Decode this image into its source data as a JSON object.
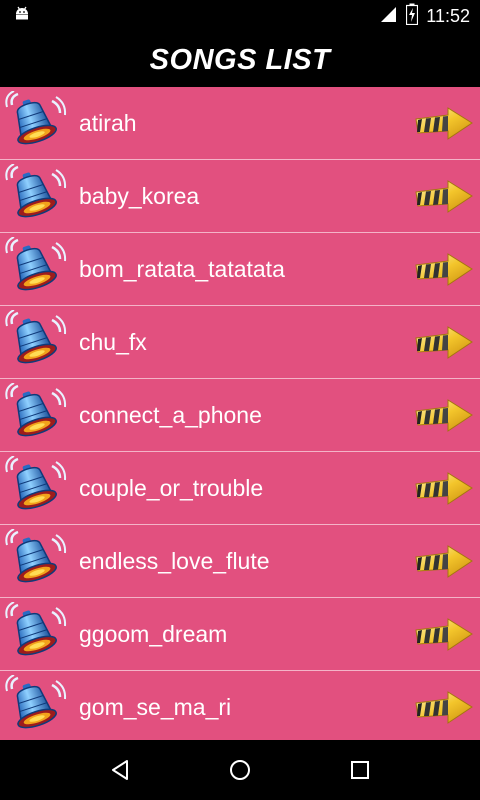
{
  "status": {
    "time": "11:52",
    "icons": [
      "android-icon",
      "wifi-icon",
      "battery-icon"
    ]
  },
  "header": {
    "title": "SONGS LIST"
  },
  "songs": [
    {
      "name": "atirah"
    },
    {
      "name": "baby_korea"
    },
    {
      "name": "bom_ratata_tatatata"
    },
    {
      "name": "chu_fx"
    },
    {
      "name": "connect_a_phone"
    },
    {
      "name": "couple_or_trouble"
    },
    {
      "name": "endless_love_flute"
    },
    {
      "name": "ggoom_dream"
    },
    {
      "name": "gom_se_ma_ri"
    }
  ],
  "navigation": {
    "buttons": [
      "back-icon",
      "home-icon",
      "recents-icon"
    ]
  },
  "colors": {
    "list_background": "#e2507f",
    "divider": "#f4b3c8",
    "bar_background": "#000000",
    "text": "#ffffff"
  }
}
